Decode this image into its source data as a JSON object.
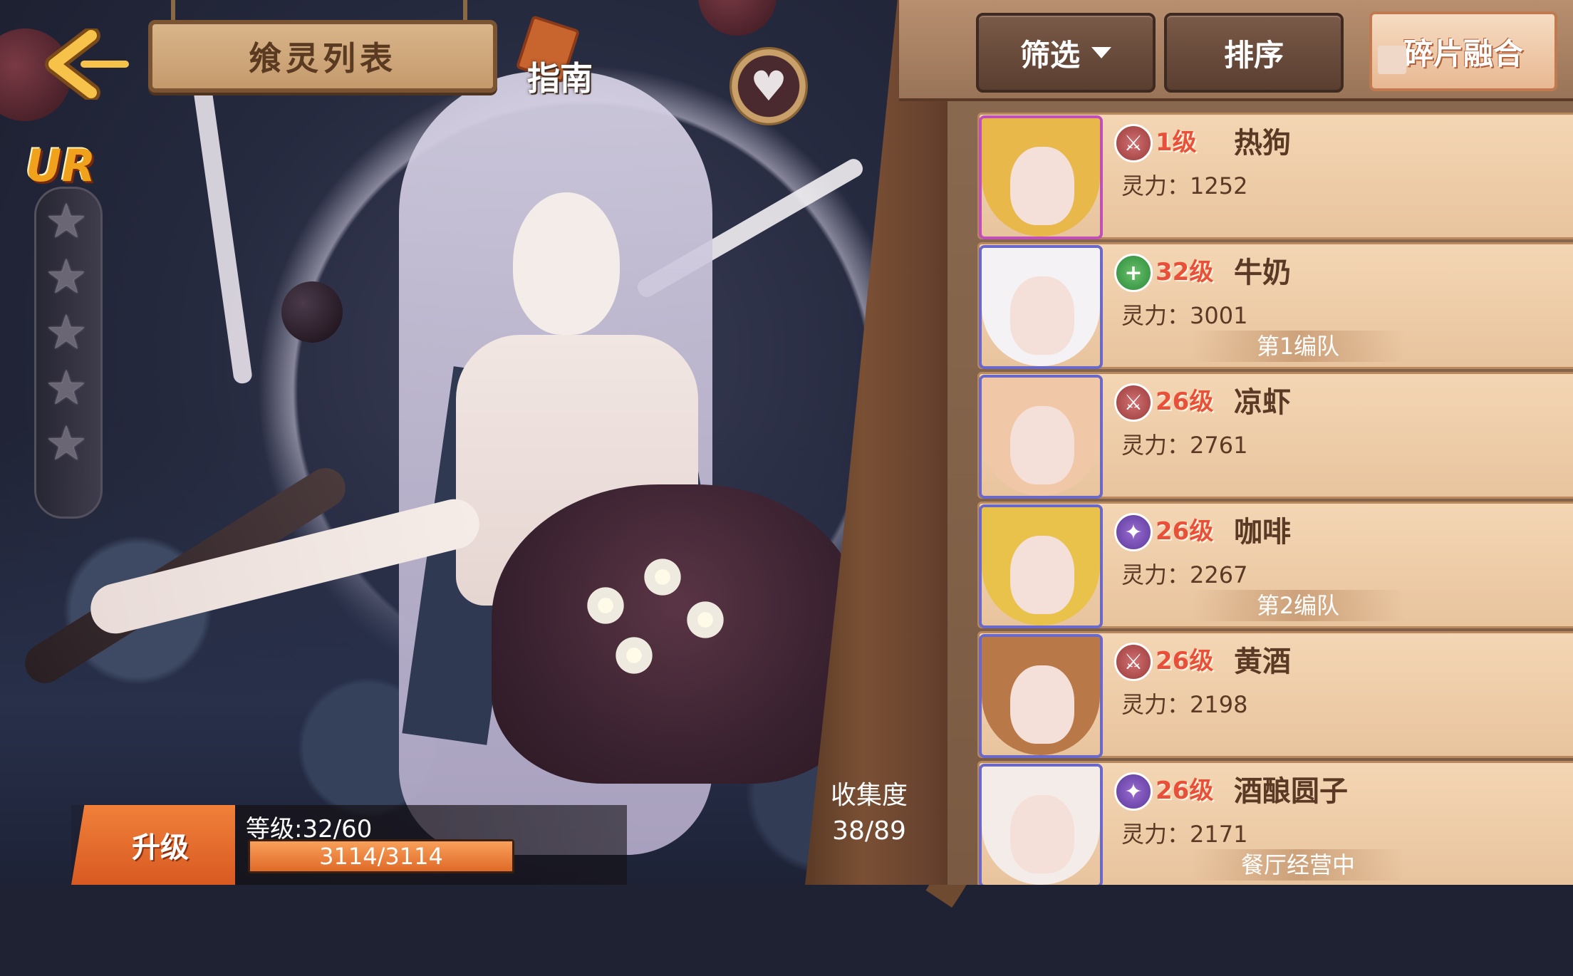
{
  "header": {
    "title": "飨灵列表",
    "guide_label": "指南",
    "back_icon": "back-arrow-icon",
    "favorite_icon": "heart-icon"
  },
  "featured": {
    "rarity": "UR",
    "stars_total": 5,
    "stars_filled": 0,
    "level_label": "等级:32/60",
    "exp_text": "3114/3114",
    "exp_fraction": 1.0,
    "upgrade_label": "升级"
  },
  "collection": {
    "label": "收集度",
    "value": "38/89"
  },
  "toolbar": {
    "filter_label": "筛选",
    "sort_label": "排序",
    "fuse_label": "碎片融合"
  },
  "colors": {
    "level_red": "#e8503a",
    "card_bg": "#f4d6b4",
    "upgrade_orange": "#e06a28"
  },
  "cards": [
    {
      "role": "attack",
      "role_icon": "crossed-swords-icon",
      "level": "1级",
      "name": "热狗",
      "power": "灵力：1252",
      "team": "",
      "frame": "pink",
      "hair": "#e8b84a"
    },
    {
      "role": "heal",
      "role_icon": "plus-icon",
      "level": "32级",
      "name": "牛奶",
      "power": "灵力：3001",
      "team": "第1编队",
      "frame": "blue",
      "hair": "#f4f2f4"
    },
    {
      "role": "attack",
      "role_icon": "crossed-swords-icon",
      "level": "26级",
      "name": "凉虾",
      "power": "灵力：2761",
      "team": "",
      "frame": "blue",
      "hair": "#f0c8a8"
    },
    {
      "role": "magic",
      "role_icon": "star-icon",
      "level": "26级",
      "name": "咖啡",
      "power": "灵力：2267",
      "team": "第2编队",
      "frame": "blue",
      "hair": "#e8c24a"
    },
    {
      "role": "attack",
      "role_icon": "crossed-swords-icon",
      "level": "26级",
      "name": "黄酒",
      "power": "灵力：2198",
      "team": "",
      "frame": "blue",
      "hair": "#b87848"
    },
    {
      "role": "magic",
      "role_icon": "star-icon",
      "level": "26级",
      "name": "酒酿圆子",
      "power": "灵力：2171",
      "team": "餐厅经营中",
      "frame": "blue",
      "hair": "#f4ece8"
    }
  ]
}
